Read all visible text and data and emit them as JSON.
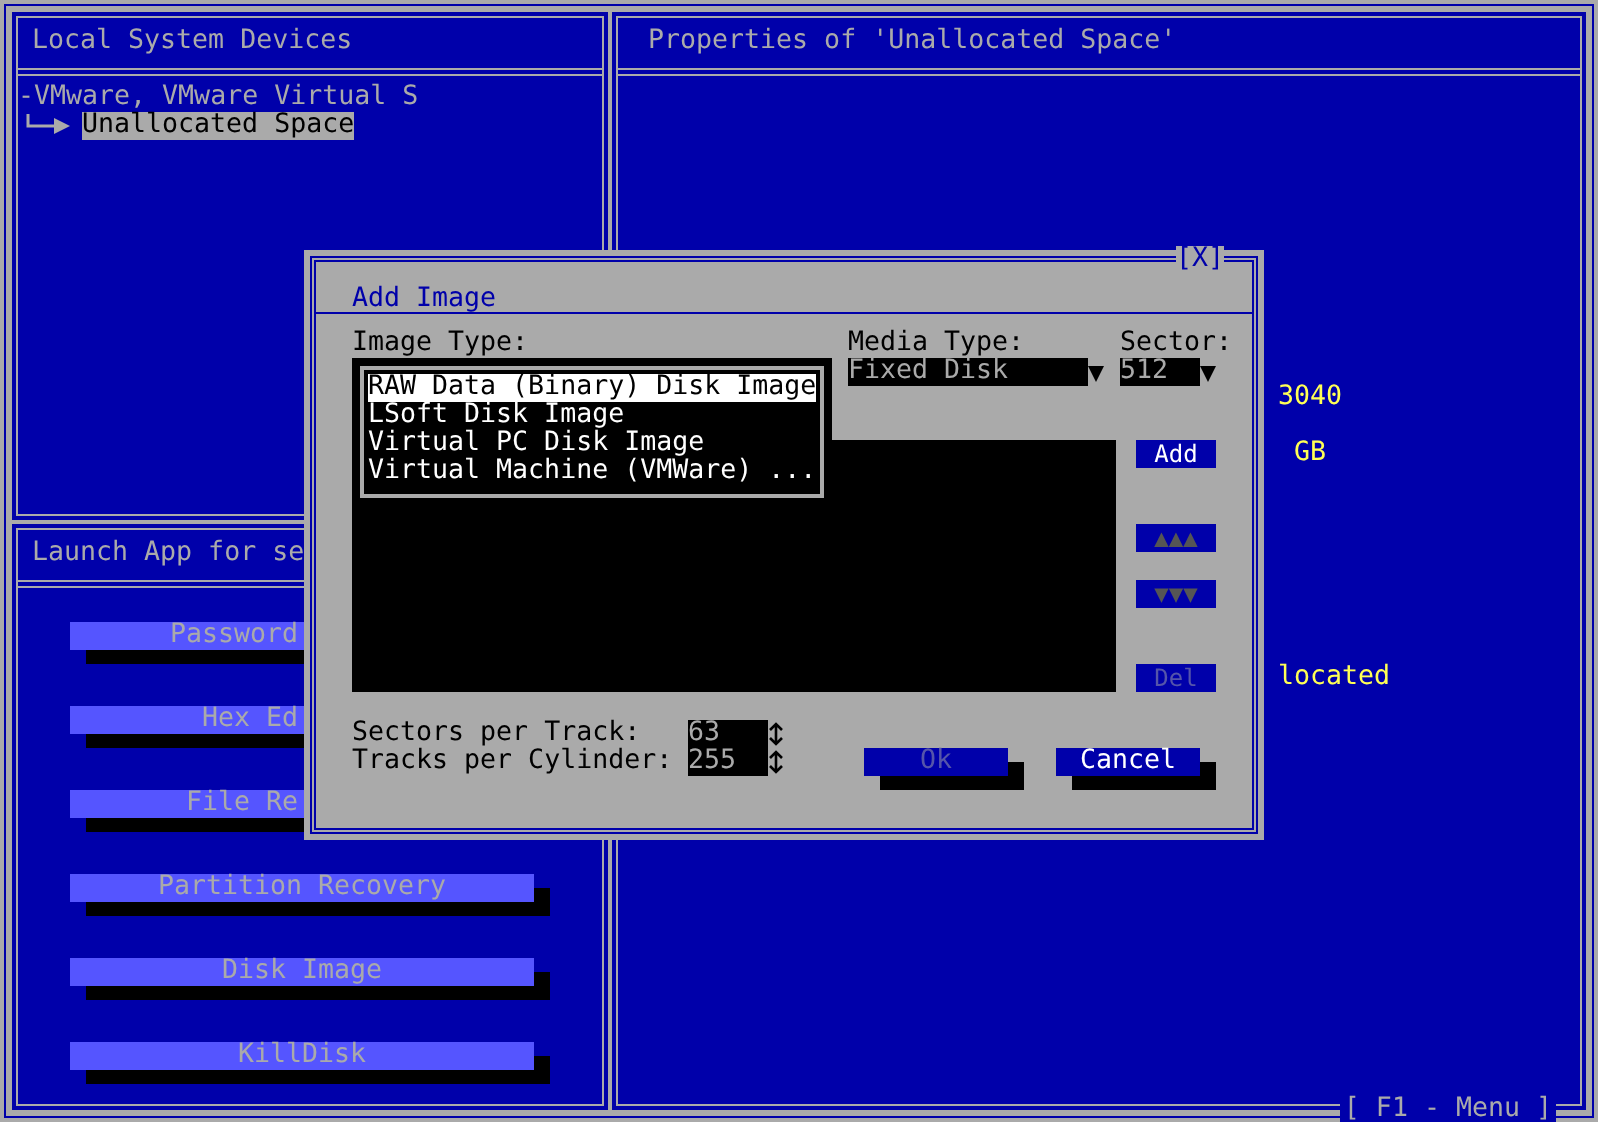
{
  "devices_panel": {
    "title": "Local System Devices",
    "tree": [
      {
        "label": "-VMware, VMware Virtual S",
        "selected": false,
        "children": [
          {
            "label": "Unallocated Space",
            "selected": true
          }
        ]
      }
    ]
  },
  "properties_panel": {
    "title": "Properties of 'Unallocated Space'",
    "values": [
      "3040",
      "GB",
      "located"
    ]
  },
  "launch_panel": {
    "title": "Launch App for se",
    "buttons": [
      {
        "label": "Password",
        "kind": "covered"
      },
      {
        "label": "Hex Ed",
        "kind": "covered"
      },
      {
        "label": "File Re",
        "kind": "covered"
      },
      {
        "label": "Partition Recovery",
        "kind": "plain"
      },
      {
        "label": "Disk Image",
        "kind": "plain"
      },
      {
        "label": "KillDisk",
        "kind": "plain"
      }
    ]
  },
  "dialog": {
    "title": "Add Image",
    "close": "[X]",
    "image_type": {
      "label": "Image Type:",
      "options": [
        {
          "label": "RAW Data (Binary) Disk Image",
          "selected": true
        },
        {
          "label": "LSoft Disk Image",
          "selected": false
        },
        {
          "label": "Virtual PC Disk Image",
          "selected": false
        },
        {
          "label": "Virtual Machine (VMWare) ...",
          "selected": false
        }
      ]
    },
    "media_type": {
      "label": "Media Type:",
      "value": "Fixed Disk"
    },
    "sector": {
      "label": "Sector:",
      "value": "512"
    },
    "side_buttons": [
      {
        "label": "Add",
        "disabled": false
      },
      {
        "label": "▲▲▲",
        "disabled": true
      },
      {
        "label": "▼▼▼",
        "disabled": true
      },
      {
        "label": "Del",
        "disabled": true
      }
    ],
    "sectors_per_track": {
      "label": "Sectors per Track:",
      "value": "63"
    },
    "tracks_per_cylinder": {
      "label": "Tracks per Cylinder:",
      "value": "255"
    },
    "buttons": [
      {
        "label": "Ok",
        "disabled": true
      },
      {
        "label": "Cancel",
        "disabled": false
      }
    ]
  },
  "status_bar": "[ F1 - Menu ]"
}
